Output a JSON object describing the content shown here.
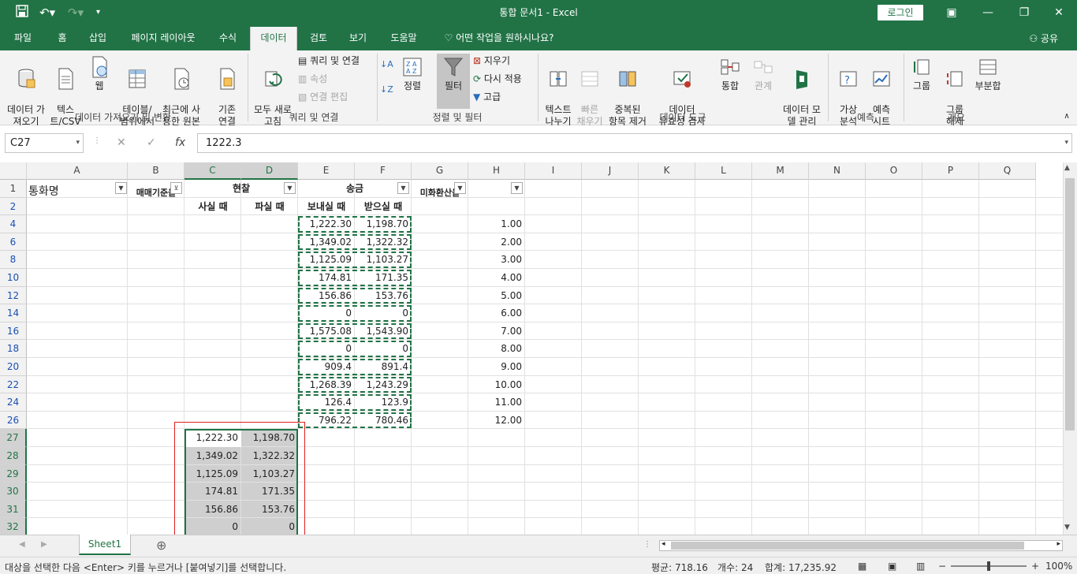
{
  "window": {
    "title": "통합 문서1  -  Excel",
    "login_label": "로그인",
    "share_label": "공유",
    "colors": {
      "excel_green": "#217346",
      "selection_gray": "#cfcfcf",
      "highlight_red": "#e02020"
    }
  },
  "tabs": [
    "파일",
    "홈",
    "삽입",
    "페이지 레이아웃",
    "수식",
    "데이터",
    "검토",
    "보기",
    "도움말"
  ],
  "active_tab": "데이터",
  "tell_me": "어떤 작업을 원하시나요?",
  "ribbon": {
    "get_data": "데이터 가\n져오기",
    "text_csv": "텍스\n트/CSV",
    "web": "웹",
    "from_table": "테이블/\n범위에서",
    "recent_sources": "최근에 사\n용한 원본",
    "existing_conn": "기존\n연결",
    "refresh_all": "모두 새로\n고침",
    "queries_conn": "쿼리 및 연결",
    "properties": "속성",
    "edit_links": "연결 편집",
    "sort_az": "↑",
    "sort_label": "정렬",
    "filter_label": "필터",
    "clear": "지우기",
    "reapply": "다시 적용",
    "advanced": "고급",
    "text_to_columns": "텍스트\n나누기",
    "flash_fill": "빠른\n채우기",
    "remove_dupes": "중복된\n항목 제거",
    "data_validation": "데이터\n유효성 검사",
    "consolidate": "통합",
    "relationships": "관계",
    "data_model": "데이터 모\n델 관리",
    "what_if": "가상\n분석",
    "forecast_sheet": "예측\n시트",
    "group": "그룹",
    "ungroup": "그룹\n해제",
    "subtotal": "부분합",
    "groups": {
      "get_transform": "데이터 가져오기 및 변환",
      "queries": "쿼리 및 연결",
      "sort_filter": "정렬 및 필터",
      "data_tools": "데이터 도구",
      "forecast": "예측",
      "outline": "개요"
    }
  },
  "formula_bar": {
    "name_box": "C27",
    "formula": "1222.3"
  },
  "columns": [
    "A",
    "B",
    "C",
    "D",
    "E",
    "F",
    "G",
    "H",
    "I",
    "J",
    "K",
    "L",
    "M",
    "N",
    "O",
    "P",
    "Q"
  ],
  "rows": [
    "1",
    "2",
    "4",
    "6",
    "8",
    "10",
    "12",
    "14",
    "16",
    "18",
    "20",
    "22",
    "24",
    "26",
    "27",
    "28",
    "29",
    "30",
    "31",
    "32"
  ],
  "headers": {
    "a1": "통화명",
    "b1": "매매기준율",
    "cd1": "현찰",
    "ef1": "송금",
    "g1": "미화환산율",
    "c2": "사실 때",
    "d2": "파실 때",
    "e2": "보내실 때",
    "f2": "받으실 때"
  },
  "filtered_rows": [
    {
      "e": "1,222.30",
      "f": "1,198.70",
      "h": "1.00"
    },
    {
      "e": "1,349.02",
      "f": "1,322.32",
      "h": "2.00"
    },
    {
      "e": "1,125.09",
      "f": "1,103.27",
      "h": "3.00"
    },
    {
      "e": "174.81",
      "f": "171.35",
      "h": "4.00"
    },
    {
      "e": "156.86",
      "f": "153.76",
      "h": "5.00"
    },
    {
      "e": "0",
      "f": "0",
      "h": "6.00"
    },
    {
      "e": "1,575.08",
      "f": "1,543.90",
      "h": "7.00"
    },
    {
      "e": "0",
      "f": "0",
      "h": "8.00"
    },
    {
      "e": "909.4",
      "f": "891.4",
      "h": "9.00"
    },
    {
      "e": "1,268.39",
      "f": "1,243.29",
      "h": "10.00"
    },
    {
      "e": "126.4",
      "f": "123.9",
      "h": "11.00"
    },
    {
      "e": "796.22",
      "f": "780.46",
      "h": "12.00"
    }
  ],
  "pasted_rows": [
    {
      "c": "1,222.30",
      "d": "1,198.70"
    },
    {
      "c": "1,349.02",
      "d": "1,322.32"
    },
    {
      "c": "1,125.09",
      "d": "1,103.27"
    },
    {
      "c": "174.81",
      "d": "171.35"
    },
    {
      "c": "156.86",
      "d": "153.76"
    },
    {
      "c": "0",
      "d": "0"
    }
  ],
  "sheet_tab": "Sheet1",
  "status": {
    "message": "대상을 선택한 다음 <Enter> 키를 누르거나 [붙여넣기]를 선택합니다.",
    "average": "평균: 718.16",
    "count": "개수: 24",
    "sum": "합계: 17,235.92",
    "zoom": "100%"
  }
}
